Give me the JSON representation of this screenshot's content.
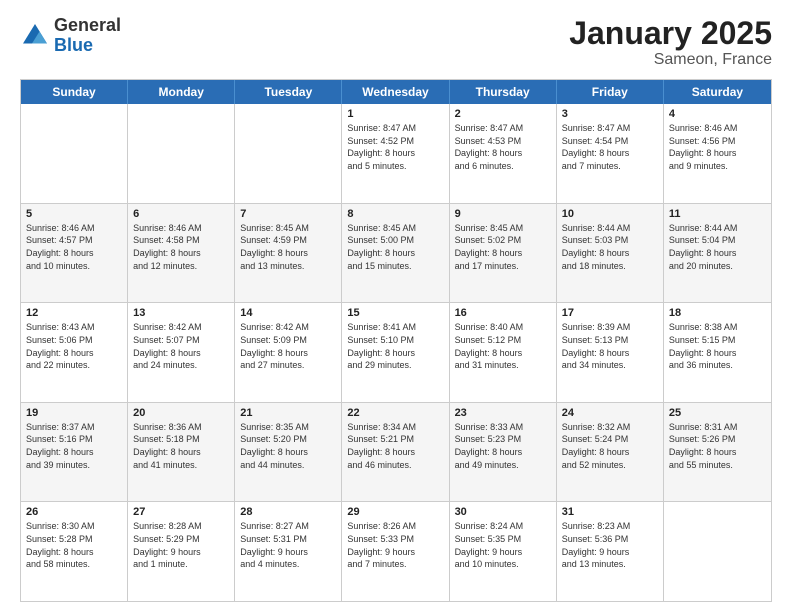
{
  "logo": {
    "general": "General",
    "blue": "Blue"
  },
  "title": "January 2025",
  "location": "Sameon, France",
  "days": [
    "Sunday",
    "Monday",
    "Tuesday",
    "Wednesday",
    "Thursday",
    "Friday",
    "Saturday"
  ],
  "weeks": [
    [
      {
        "day": "",
        "text": ""
      },
      {
        "day": "",
        "text": ""
      },
      {
        "day": "",
        "text": ""
      },
      {
        "day": "1",
        "text": "Sunrise: 8:47 AM\nSunset: 4:52 PM\nDaylight: 8 hours\nand 5 minutes."
      },
      {
        "day": "2",
        "text": "Sunrise: 8:47 AM\nSunset: 4:53 PM\nDaylight: 8 hours\nand 6 minutes."
      },
      {
        "day": "3",
        "text": "Sunrise: 8:47 AM\nSunset: 4:54 PM\nDaylight: 8 hours\nand 7 minutes."
      },
      {
        "day": "4",
        "text": "Sunrise: 8:46 AM\nSunset: 4:56 PM\nDaylight: 8 hours\nand 9 minutes."
      }
    ],
    [
      {
        "day": "5",
        "text": "Sunrise: 8:46 AM\nSunset: 4:57 PM\nDaylight: 8 hours\nand 10 minutes."
      },
      {
        "day": "6",
        "text": "Sunrise: 8:46 AM\nSunset: 4:58 PM\nDaylight: 8 hours\nand 12 minutes."
      },
      {
        "day": "7",
        "text": "Sunrise: 8:45 AM\nSunset: 4:59 PM\nDaylight: 8 hours\nand 13 minutes."
      },
      {
        "day": "8",
        "text": "Sunrise: 8:45 AM\nSunset: 5:00 PM\nDaylight: 8 hours\nand 15 minutes."
      },
      {
        "day": "9",
        "text": "Sunrise: 8:45 AM\nSunset: 5:02 PM\nDaylight: 8 hours\nand 17 minutes."
      },
      {
        "day": "10",
        "text": "Sunrise: 8:44 AM\nSunset: 5:03 PM\nDaylight: 8 hours\nand 18 minutes."
      },
      {
        "day": "11",
        "text": "Sunrise: 8:44 AM\nSunset: 5:04 PM\nDaylight: 8 hours\nand 20 minutes."
      }
    ],
    [
      {
        "day": "12",
        "text": "Sunrise: 8:43 AM\nSunset: 5:06 PM\nDaylight: 8 hours\nand 22 minutes."
      },
      {
        "day": "13",
        "text": "Sunrise: 8:42 AM\nSunset: 5:07 PM\nDaylight: 8 hours\nand 24 minutes."
      },
      {
        "day": "14",
        "text": "Sunrise: 8:42 AM\nSunset: 5:09 PM\nDaylight: 8 hours\nand 27 minutes."
      },
      {
        "day": "15",
        "text": "Sunrise: 8:41 AM\nSunset: 5:10 PM\nDaylight: 8 hours\nand 29 minutes."
      },
      {
        "day": "16",
        "text": "Sunrise: 8:40 AM\nSunset: 5:12 PM\nDaylight: 8 hours\nand 31 minutes."
      },
      {
        "day": "17",
        "text": "Sunrise: 8:39 AM\nSunset: 5:13 PM\nDaylight: 8 hours\nand 34 minutes."
      },
      {
        "day": "18",
        "text": "Sunrise: 8:38 AM\nSunset: 5:15 PM\nDaylight: 8 hours\nand 36 minutes."
      }
    ],
    [
      {
        "day": "19",
        "text": "Sunrise: 8:37 AM\nSunset: 5:16 PM\nDaylight: 8 hours\nand 39 minutes."
      },
      {
        "day": "20",
        "text": "Sunrise: 8:36 AM\nSunset: 5:18 PM\nDaylight: 8 hours\nand 41 minutes."
      },
      {
        "day": "21",
        "text": "Sunrise: 8:35 AM\nSunset: 5:20 PM\nDaylight: 8 hours\nand 44 minutes."
      },
      {
        "day": "22",
        "text": "Sunrise: 8:34 AM\nSunset: 5:21 PM\nDaylight: 8 hours\nand 46 minutes."
      },
      {
        "day": "23",
        "text": "Sunrise: 8:33 AM\nSunset: 5:23 PM\nDaylight: 8 hours\nand 49 minutes."
      },
      {
        "day": "24",
        "text": "Sunrise: 8:32 AM\nSunset: 5:24 PM\nDaylight: 8 hours\nand 52 minutes."
      },
      {
        "day": "25",
        "text": "Sunrise: 8:31 AM\nSunset: 5:26 PM\nDaylight: 8 hours\nand 55 minutes."
      }
    ],
    [
      {
        "day": "26",
        "text": "Sunrise: 8:30 AM\nSunset: 5:28 PM\nDaylight: 8 hours\nand 58 minutes."
      },
      {
        "day": "27",
        "text": "Sunrise: 8:28 AM\nSunset: 5:29 PM\nDaylight: 9 hours\nand 1 minute."
      },
      {
        "day": "28",
        "text": "Sunrise: 8:27 AM\nSunset: 5:31 PM\nDaylight: 9 hours\nand 4 minutes."
      },
      {
        "day": "29",
        "text": "Sunrise: 8:26 AM\nSunset: 5:33 PM\nDaylight: 9 hours\nand 7 minutes."
      },
      {
        "day": "30",
        "text": "Sunrise: 8:24 AM\nSunset: 5:35 PM\nDaylight: 9 hours\nand 10 minutes."
      },
      {
        "day": "31",
        "text": "Sunrise: 8:23 AM\nSunset: 5:36 PM\nDaylight: 9 hours\nand 13 minutes."
      },
      {
        "day": "",
        "text": ""
      }
    ]
  ]
}
